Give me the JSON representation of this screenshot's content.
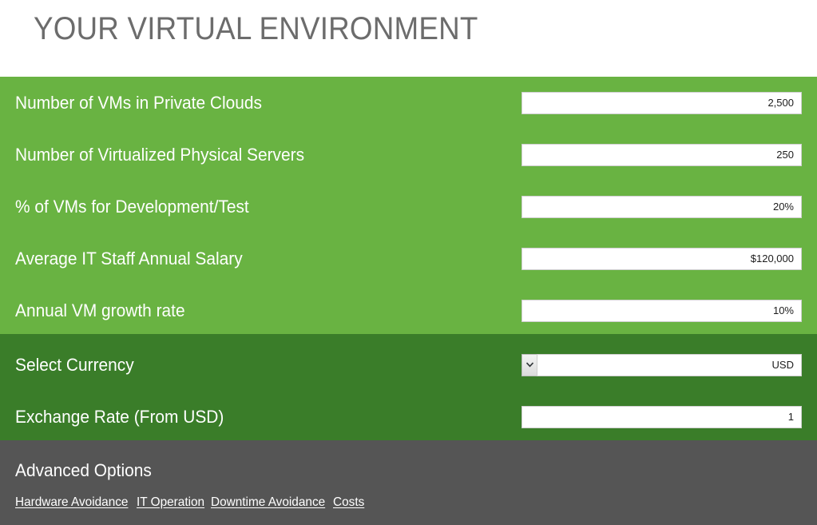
{
  "header": {
    "title": "YOUR VIRTUAL ENVIRONMENT"
  },
  "colors": {
    "band_primary": "#69b342",
    "band_secondary": "#3a7d29",
    "band_footer": "#555555",
    "title_text": "#6c6c6c",
    "label_text": "#ffffff",
    "field_text": "#1c1c1c"
  },
  "primary_section": {
    "rows": [
      {
        "label": "Number of VMs in Private Clouds",
        "value": "2,500",
        "placeholder": ""
      },
      {
        "label": "Number of Virtualized Physical Servers",
        "value": "250",
        "placeholder": ""
      },
      {
        "label": "% of VMs for Development/Test",
        "value": "20%",
        "placeholder": ""
      },
      {
        "label": "Average IT Staff Annual Salary",
        "value": "$120,000",
        "placeholder": ""
      },
      {
        "label": "Annual VM growth rate",
        "value": "10%",
        "placeholder": ""
      }
    ]
  },
  "currency_section": {
    "currency_row": {
      "label": "Select Currency",
      "value": "USD",
      "dropdown_icon": "chevron-down-icon"
    },
    "exchange_row": {
      "label": "Exchange Rate (From USD)",
      "value": "1",
      "placeholder": ""
    }
  },
  "footer": {
    "heading": "Advanced Options",
    "links": [
      {
        "label": "Hardware Avoidance"
      },
      {
        "label": "IT Operation"
      },
      {
        "label": "Downtime Avoidance"
      },
      {
        "label": "Costs"
      }
    ]
  }
}
